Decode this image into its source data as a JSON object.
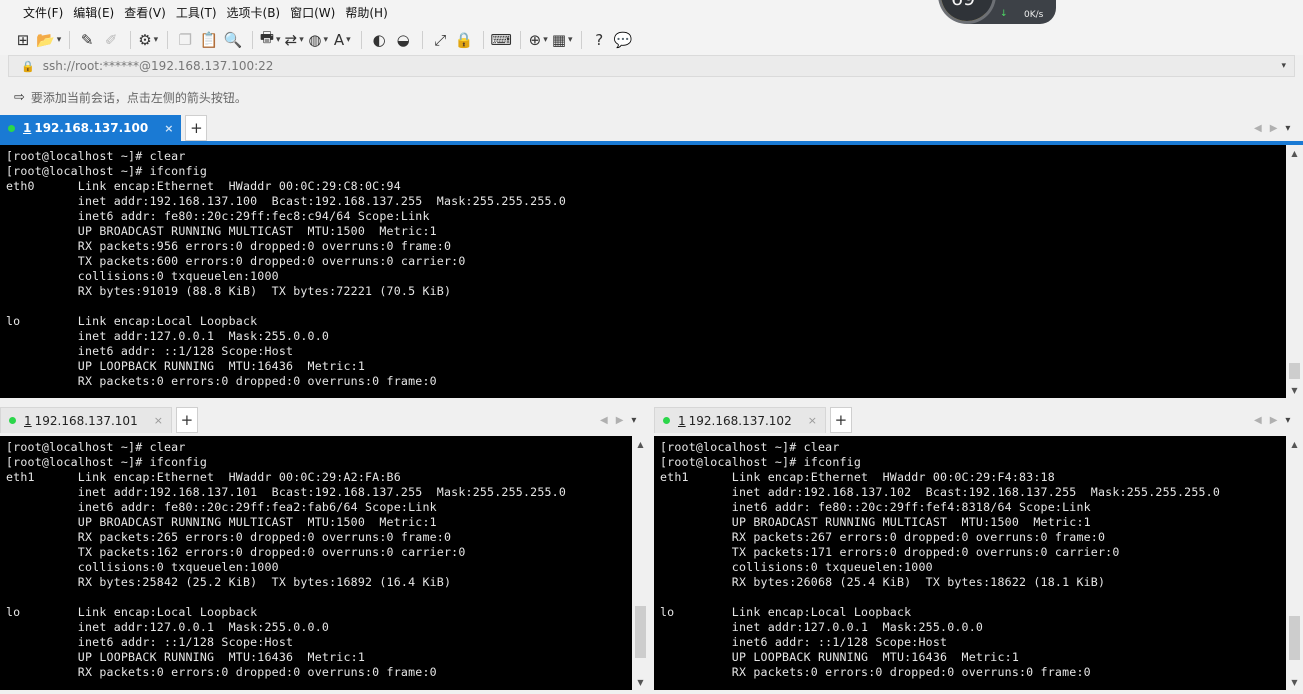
{
  "menubar": {
    "items": [
      "文件(F)",
      "编辑(E)",
      "查看(V)",
      "工具(T)",
      "选项卡(B)",
      "窗口(W)",
      "帮助(H)"
    ]
  },
  "netwidget": {
    "percent": "69",
    "percent_unit": "%",
    "rate": "0K/s",
    "arrow": "↓"
  },
  "toolbar": {
    "icons": [
      {
        "name": "new-session-icon",
        "glyph": "⊞"
      },
      {
        "name": "open-folder-icon",
        "glyph": "📂"
      },
      {
        "name": "reconnect-icon",
        "glyph": "✎"
      },
      {
        "name": "disconnect-icon",
        "glyph": "✐"
      },
      {
        "name": "properties-icon",
        "glyph": "⚙"
      },
      {
        "name": "copy-icon",
        "glyph": "❐"
      },
      {
        "name": "paste-icon",
        "glyph": "📋"
      },
      {
        "name": "find-icon",
        "glyph": "🔍"
      },
      {
        "name": "print-icon",
        "glyph": "🖶"
      },
      {
        "name": "transfer-icon",
        "glyph": "⇄"
      },
      {
        "name": "globe-icon",
        "glyph": "◍"
      },
      {
        "name": "font-icon",
        "glyph": "A"
      },
      {
        "name": "xftp-icon",
        "glyph": "◐"
      },
      {
        "name": "xshell-icon",
        "glyph": "◒"
      },
      {
        "name": "fullscreen-icon",
        "glyph": "⤢"
      },
      {
        "name": "lock-icon",
        "glyph": "🔒"
      },
      {
        "name": "keyboard-icon",
        "glyph": "⌨"
      },
      {
        "name": "add-tab-icon",
        "glyph": "⊕"
      },
      {
        "name": "layout-icon",
        "glyph": "▦"
      },
      {
        "name": "help-icon",
        "glyph": "?"
      },
      {
        "name": "chat-icon",
        "glyph": "💬"
      }
    ]
  },
  "address": {
    "text": "ssh://root:******@192.168.137.100:22",
    "lock_icon": "🔒"
  },
  "hint": {
    "text": "要添加当前会话，点击左侧的箭头按钮。"
  },
  "panes": {
    "top": {
      "tab_num": "1",
      "tab_host": "192.168.137.100",
      "close": "×",
      "add": "+",
      "lines": "[root@localhost ~]# clear\n[root@localhost ~]# ifconfig\neth0      Link encap:Ethernet  HWaddr 00:0C:29:C8:0C:94\n          inet addr:192.168.137.100  Bcast:192.168.137.255  Mask:255.255.255.0\n          inet6 addr: fe80::20c:29ff:fec8:c94/64 Scope:Link\n          UP BROADCAST RUNNING MULTICAST  MTU:1500  Metric:1\n          RX packets:956 errors:0 dropped:0 overruns:0 frame:0\n          TX packets:600 errors:0 dropped:0 overruns:0 carrier:0\n          collisions:0 txqueuelen:1000\n          RX bytes:91019 (88.8 KiB)  TX bytes:72221 (70.5 KiB)\n\nlo        Link encap:Local Loopback\n          inet addr:127.0.0.1  Mask:255.0.0.0\n          inet6 addr: ::1/128 Scope:Host\n          UP LOOPBACK RUNNING  MTU:16436  Metric:1\n          RX packets:0 errors:0 dropped:0 overruns:0 frame:0"
    },
    "bottom_left": {
      "tab_num": "1",
      "tab_host": "192.168.137.101",
      "close": "×",
      "add": "+",
      "lines": "[root@localhost ~]# clear\n[root@localhost ~]# ifconfig\neth1      Link encap:Ethernet  HWaddr 00:0C:29:A2:FA:B6\n          inet addr:192.168.137.101  Bcast:192.168.137.255  Mask:255.255.255.0\n          inet6 addr: fe80::20c:29ff:fea2:fab6/64 Scope:Link\n          UP BROADCAST RUNNING MULTICAST  MTU:1500  Metric:1\n          RX packets:265 errors:0 dropped:0 overruns:0 frame:0\n          TX packets:162 errors:0 dropped:0 overruns:0 carrier:0\n          collisions:0 txqueuelen:1000\n          RX bytes:25842 (25.2 KiB)  TX bytes:16892 (16.4 KiB)\n\nlo        Link encap:Local Loopback\n          inet addr:127.0.0.1  Mask:255.0.0.0\n          inet6 addr: ::1/128 Scope:Host\n          UP LOOPBACK RUNNING  MTU:16436  Metric:1\n          RX packets:0 errors:0 dropped:0 overruns:0 frame:0"
    },
    "bottom_right": {
      "tab_num": "1",
      "tab_host": "192.168.137.102",
      "close": "×",
      "add": "+",
      "lines": "[root@localhost ~]# clear\n[root@localhost ~]# ifconfig\neth1      Link encap:Ethernet  HWaddr 00:0C:29:F4:83:18\n          inet addr:192.168.137.102  Bcast:192.168.137.255  Mask:255.255.255.0\n          inet6 addr: fe80::20c:29ff:fef4:8318/64 Scope:Link\n          UP BROADCAST RUNNING MULTICAST  MTU:1500  Metric:1\n          RX packets:267 errors:0 dropped:0 overruns:0 frame:0\n          TX packets:171 errors:0 dropped:0 overruns:0 carrier:0\n          collisions:0 txqueuelen:1000\n          RX bytes:26068 (25.4 KiB)  TX bytes:18622 (18.1 KiB)\n\nlo        Link encap:Local Loopback\n          inet addr:127.0.0.1  Mask:255.0.0.0\n          inet6 addr: ::1/128 Scope:Host\n          UP LOOPBACK RUNNING  MTU:16436  Metric:1\n          RX packets:0 errors:0 dropped:0 overruns:0 frame:0"
    }
  },
  "tabnav": {
    "prev": "◀",
    "next": "▶",
    "menu": "▾"
  },
  "scroll": {
    "up": "▲",
    "down": "▼"
  },
  "colors": {
    "accent": "#1a7ad4",
    "terminal_bg": "#000000",
    "terminal_fg": "#e6e6e6",
    "status_dot": "#2bd64a"
  }
}
